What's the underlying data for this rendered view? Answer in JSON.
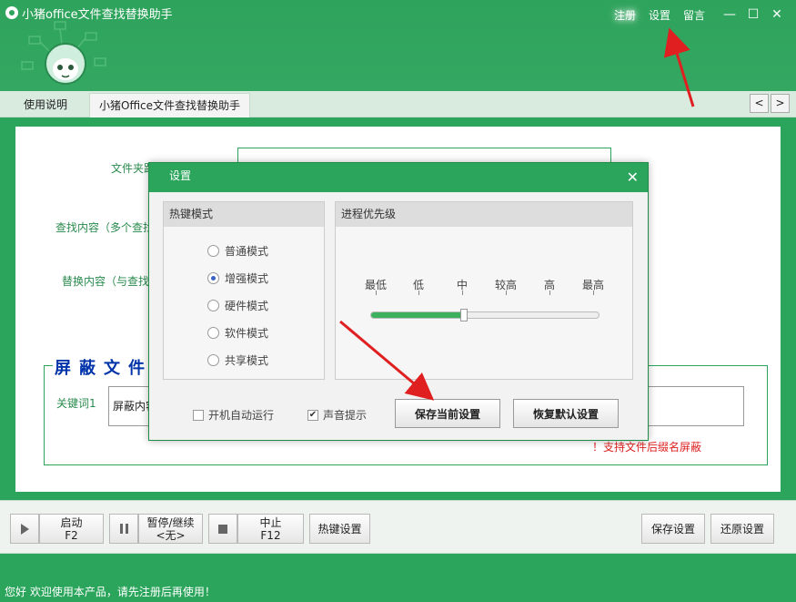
{
  "app": {
    "title": "小猪office文件查找替换助手",
    "top_links": [
      "注册",
      "设置",
      "留言"
    ]
  },
  "window_controls": {
    "minimize": "—",
    "maximize": "☐",
    "close": "✕"
  },
  "tabs": [
    {
      "label": "使用说明",
      "active": false
    },
    {
      "label": "小猪Office文件查找替换助手",
      "active": true
    }
  ],
  "nav": {
    "prev": "<",
    "next": ">"
  },
  "main": {
    "file_label": "文件夹路径（点击选择）",
    "find_label": "查找内容（多个查找",
    "replace_label": "替换内容（与查找",
    "shield_group_title": "屏蔽文件名",
    "keyword_label": "关键词1",
    "keyword_value": "屏蔽内容",
    "support_note": "！支持文件后缀名屏蔽"
  },
  "toolbar": {
    "start_label": "启动",
    "start_key": "F2",
    "pause_label": "暂停/继续",
    "pause_key": "<无>",
    "stop_label": "中止",
    "stop_key": "F12",
    "hotkey_settings": "热键设置",
    "save_settings": "保存设置",
    "restore_settings": "还原设置"
  },
  "status": {
    "text": "您好 欢迎使用本产品，请先注册后再使用！"
  },
  "dialog": {
    "title": "设置",
    "close": "✕",
    "hotkey_panel": {
      "header": "热键模式",
      "options": [
        {
          "label": "普通模式",
          "checked": false
        },
        {
          "label": "增强模式",
          "checked": true
        },
        {
          "label": "硬件模式",
          "checked": false
        },
        {
          "label": "软件模式",
          "checked": false
        },
        {
          "label": "共享模式",
          "checked": false
        }
      ]
    },
    "priority_panel": {
      "header": "进程优先级",
      "levels": [
        "最低",
        "低",
        "中",
        "较高",
        "高",
        "最高"
      ],
      "selected_index": 2
    },
    "autostart": {
      "label": "开机自动运行",
      "checked": false
    },
    "sound": {
      "label": "声音提示",
      "checked": true
    },
    "save_current": "保存当前设置",
    "restore_default": "恢复默认设置"
  },
  "colors": {
    "brand_green": "#2aa55b",
    "label_green": "#2a8a4e",
    "group_title_blue": "#0033aa",
    "warning_red": "#dd2222",
    "annotation_red": "#e02020"
  }
}
